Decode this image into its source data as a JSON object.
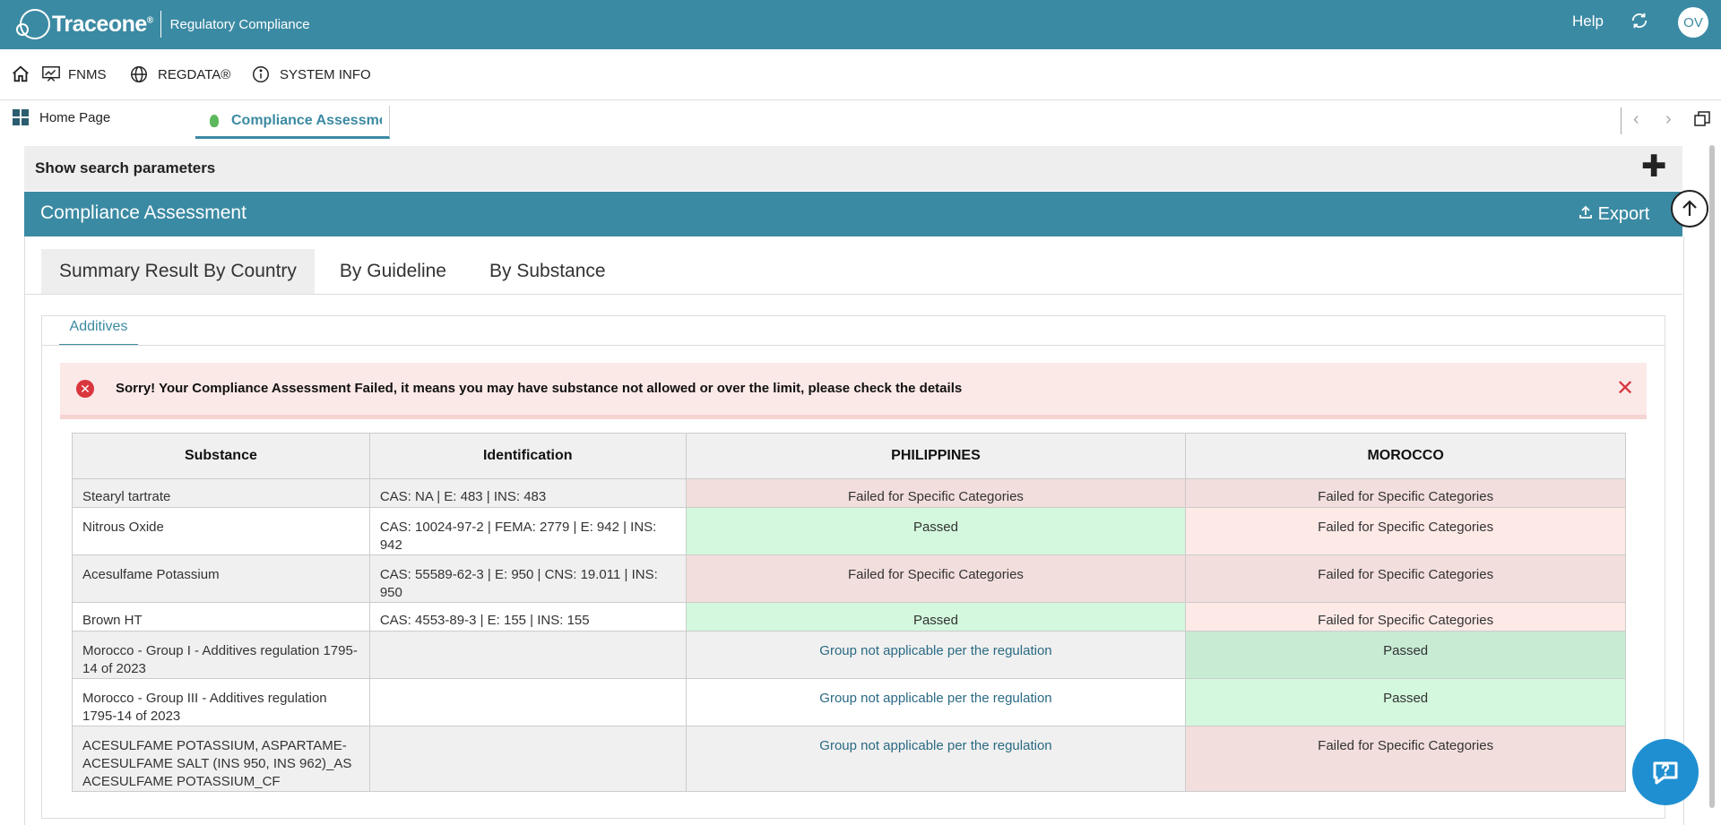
{
  "app": {
    "brand": "Traceone",
    "brand_suffix": "®",
    "subtitle": "Regulatory Compliance",
    "help": "Help",
    "user_initials": "OV"
  },
  "menu": {
    "fnms": "FNMS",
    "regdata": "REGDATA®",
    "system_info": "SYSTEM INFO"
  },
  "tabs": {
    "home": "Home Page",
    "active": "Compliance Assessment"
  },
  "search": {
    "label": "Show search parameters",
    "toggle": "✚"
  },
  "panel": {
    "title": "Compliance Assessment",
    "export": "Export"
  },
  "main_tabs": [
    "Summary Result By Country",
    "By Guideline",
    "By Substance"
  ],
  "sub_tab": "Additives",
  "alert": {
    "message": "Sorry! Your Compliance Assessment Failed, it means you may have substance not allowed or over the limit, please check the details"
  },
  "table": {
    "headers": [
      "Substance",
      "Identification",
      "PHILIPPINES",
      "MOROCCO"
    ],
    "rows": [
      {
        "substance": "Stearyl tartrate",
        "identification": "CAS: NA | E: 483 | INS: 483",
        "philippines": "Failed for Specific Categories",
        "morocco": "Failed for Specific Categories"
      },
      {
        "substance": "Nitrous Oxide",
        "identification": "CAS: 10024-97-2 | FEMA: 2779 | E: 942 | INS: 942",
        "philippines": "Passed",
        "morocco": "Failed for Specific Categories"
      },
      {
        "substance": "Acesulfame Potassium",
        "identification": "CAS: 55589-62-3 | E: 950 | CNS: 19.011 | INS: 950",
        "philippines": "Failed for Specific Categories",
        "morocco": "Failed for Specific Categories"
      },
      {
        "substance": "Brown HT",
        "identification": "CAS: 4553-89-3 | E: 155 | INS: 155",
        "philippines": "Passed",
        "morocco": "Failed for Specific Categories"
      },
      {
        "substance": "Morocco - Group I - Additives regulation 1795-14 of 2023",
        "identification": "",
        "philippines": "Group not applicable per the regulation",
        "morocco": "Passed"
      },
      {
        "substance": "Morocco - Group III - Additives regulation 1795-14 of 2023",
        "identification": "",
        "philippines": "Group not applicable per the regulation",
        "morocco": "Passed"
      },
      {
        "substance": "ACESULFAME POTASSIUM, ASPARTAME-ACESULFAME SALT (INS 950, INS 962)_AS ACESULFAME POTASSIUM_CF",
        "identification": "",
        "philippines": "Group not applicable per the regulation",
        "morocco": "Failed for Specific Categories"
      }
    ]
  },
  "colors": {
    "brand": "#3b8aa3",
    "fail_bg": "#f2dedc",
    "pass_bg": "#d3f8dd",
    "error": "#d9363e",
    "chat": "#1f8fd1"
  }
}
